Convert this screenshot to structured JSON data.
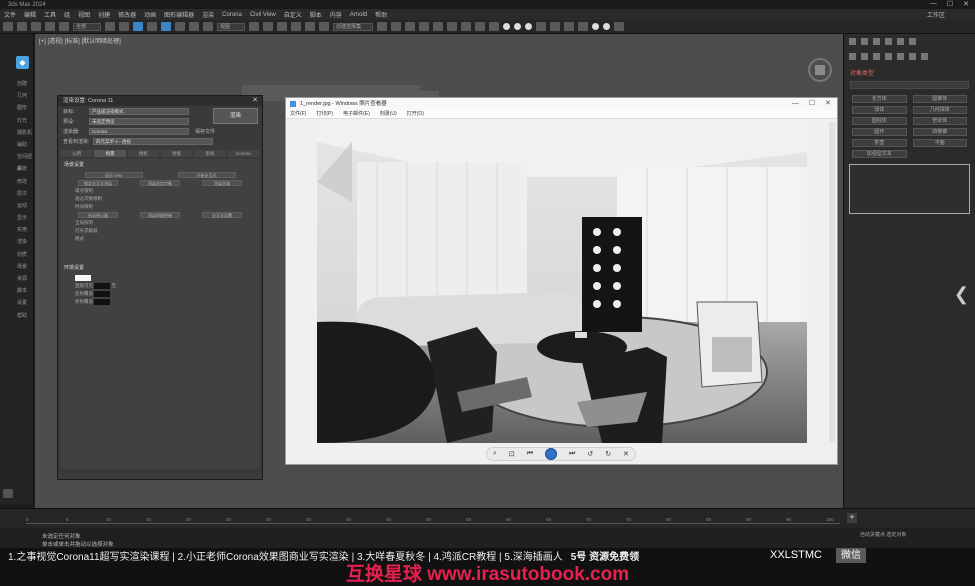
{
  "app": {
    "title": "3ds Max 2024",
    "menus": [
      "文件",
      "编辑",
      "工具",
      "组",
      "视图",
      "创建",
      "修改器",
      "动画",
      "图形编辑器",
      "渲染",
      "Corona",
      "Civil View",
      "自定义",
      "脚本",
      "内容",
      "Arnold",
      "帮助"
    ],
    "workspace": "工作区"
  },
  "toolbar": {
    "selection_filter": "全部",
    "view_label": "视图",
    "named_set": "创建选择集"
  },
  "leftdock": {
    "items": [
      "创建",
      "几何",
      "图形",
      "灯光",
      "摄影机",
      "辅助",
      "空间扭曲",
      "系统",
      "修改",
      "层次",
      "运动",
      "显示",
      "实用",
      "渲染",
      "材质",
      "场景",
      "资源",
      "脚本",
      "设置",
      "帮助"
    ]
  },
  "viewport": {
    "label": "[+] [透视] [标准] [默认明暗处理]"
  },
  "dialog": {
    "title": "渲染设置: Corona 11",
    "rows": [
      {
        "label": "目标:",
        "value": "产品级渲染模式"
      },
      {
        "label": "预设:",
        "value": "未选定预设"
      },
      {
        "label": "渲染器:",
        "value": "Corona"
      }
    ],
    "save_label": "保存文件",
    "view_label": "查看到渲染:",
    "view_value": "四元菜单 4 - 透视",
    "render_button": "渲染",
    "tabs": [
      "公用",
      "场景",
      "相机",
      "性能",
      "系统",
      "Corona Converter"
    ],
    "sections": {
      "scene": "场景设置",
      "env": "环境设置"
    },
    "buttons_row1": [
      "显示 VFB",
      "开始交互式"
    ],
    "buttons_row2": [
      "锁定交互式渲染",
      "渲染选定对象",
      "渲染区域"
    ],
    "buttons_row3": [
      "启动停止器",
      "渲染质量控制",
      "交互式设置"
    ],
    "labels": {
      "noise": "噪点限制",
      "passes": "通过次数限制",
      "time": "时间限制",
      "gi": "全局照明",
      "light_solver": "灯光求解器",
      "mode": "模式",
      "direct": "直接可见",
      "reflect": "反射覆盖",
      "refract": "折射覆盖"
    },
    "bg_none": "无"
  },
  "vfb": {
    "title": "1_render.jpg - Windows 照片查看器",
    "menus": [
      "文件(F)",
      "打印(P)",
      "电子邮件(E)",
      "刻录(U)",
      "打开(O)"
    ],
    "nav": [
      "zoom-icon",
      "actual-size-icon",
      "prev-icon",
      "slideshow-icon",
      "next-icon",
      "rotate-left-icon",
      "rotate-right-icon",
      "delete-icon"
    ]
  },
  "rightdock": {
    "head": "对象类型",
    "buttons": [
      "长方体",
      "圆锥体",
      "球体",
      "几何球体",
      "圆柱体",
      "管状体",
      "圆环",
      "四棱锥",
      "茶壶",
      "平面",
      "加强型文本"
    ]
  },
  "timeline": {
    "ticks": [
      "0",
      "5",
      "10",
      "15",
      "20",
      "25",
      "30",
      "35",
      "40",
      "45",
      "50",
      "55",
      "60",
      "65",
      "70",
      "75",
      "80",
      "85",
      "90",
      "95",
      "100"
    ],
    "frame": "0 / 100"
  },
  "status": {
    "line1": "未选定任何对象",
    "line2": "单击或单击并拖动以选择对象",
    "right": "自动关键点  选定对象"
  },
  "banner": {
    "text": "1.之事视觉Corona11超写实渲染课程 | 2.小正老师Corona效果图商业写实渲染 | 3.大咩春夏秋冬 | 4.鸿派CR教程 | 5.深海插画人",
    "logo": "5号 资源免费领",
    "right": "XXLSTMC",
    "wechat": "微信"
  },
  "watermark": "互换星球 www.irasutobook.com"
}
